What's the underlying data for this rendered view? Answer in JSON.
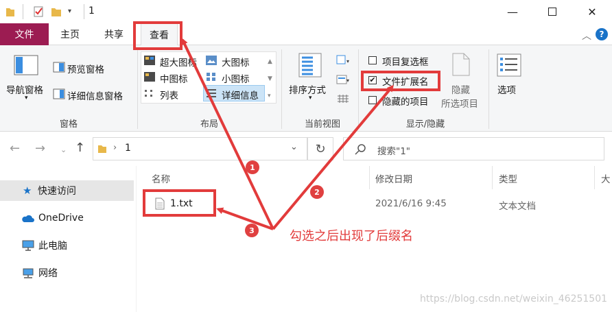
{
  "window": {
    "title": "1"
  },
  "tabs": {
    "file": "文件",
    "home": "主页",
    "share": "共享",
    "view": "查看"
  },
  "ribbon": {
    "panes": {
      "nav_pane": "导航窗格",
      "preview": "预览窗格",
      "details_pane": "详细信息窗格",
      "group": "窗格"
    },
    "layout": {
      "extra_large": "超大图标",
      "large": "大图标",
      "medium": "中图标",
      "small": "小图标",
      "list": "列表",
      "details": "详细信息",
      "group": "布局"
    },
    "current_view": {
      "sort": "排序方式",
      "group": "当前视图"
    },
    "show_hide": {
      "item_checkbox": "项目复选框",
      "file_ext": "文件扩展名",
      "hidden_items": "隐藏的项目",
      "hide_selected_1": "隐藏",
      "hide_selected_2": "所选项目",
      "group": "显示/隐藏"
    },
    "options": "选项"
  },
  "address": {
    "folder": "1"
  },
  "search": {
    "placeholder": "搜索\"1\""
  },
  "nav_pane": {
    "items": [
      "快速访问",
      "OneDrive",
      "此电脑",
      "网络"
    ]
  },
  "file_list": {
    "columns": [
      "名称",
      "修改日期",
      "类型",
      "大"
    ],
    "rows": [
      {
        "name": "1.txt",
        "date": "2021/6/16 9:45",
        "type": "文本文档"
      }
    ]
  },
  "annotation": {
    "text": "勾选之后出现了后缀名",
    "badges": [
      "1",
      "2",
      "3"
    ]
  },
  "watermark": "https://blog.csdn.net/weixin_46251501",
  "colors": {
    "accent": "#9c1c52",
    "annotation": "#e23b3b",
    "highlight_row": "#e5f0fb"
  }
}
